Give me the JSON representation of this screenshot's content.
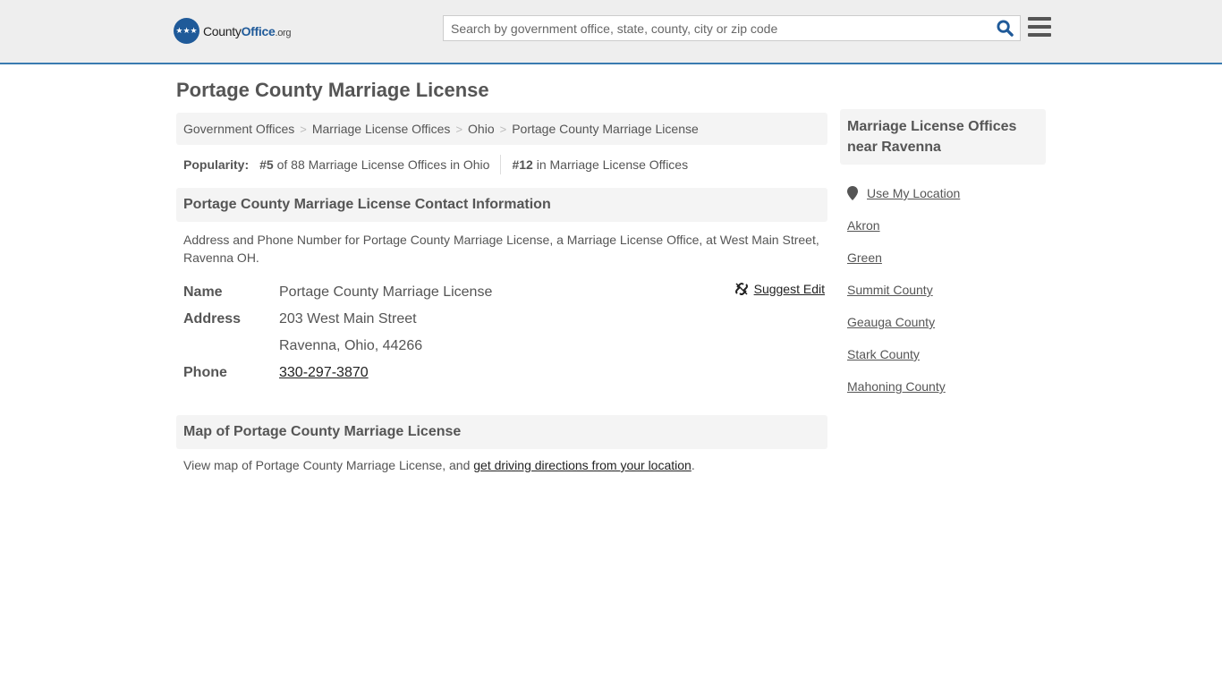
{
  "header": {
    "logo_text_a": "County",
    "logo_text_b": "Office",
    "logo_text_c": ".org",
    "search_placeholder": "Search by government office, state, county, city or zip code",
    "search_icon": "search-icon",
    "menu_icon": "hamburger-menu-icon"
  },
  "page": {
    "title": "Portage County Marriage License"
  },
  "breadcrumb": [
    "Government Offices",
    "Marriage License Offices",
    "Ohio",
    "Portage County Marriage License"
  ],
  "popularity": {
    "label": "Popularity:",
    "state_rank": "#5",
    "state_text": " of 88 Marriage License Offices in Ohio",
    "national_rank": "#12",
    "national_text": " in Marriage License Offices"
  },
  "contact": {
    "heading": "Portage County Marriage License Contact Information",
    "description": "Address and Phone Number for Portage County Marriage License, a Marriage License Office, at West Main Street, Ravenna OH.",
    "suggest_edit": "Suggest Edit",
    "name_label": "Name",
    "name_value": "Portage County Marriage License",
    "address_label": "Address",
    "address_line1": "203 West Main Street",
    "address_line2": "Ravenna, Ohio, 44266",
    "phone_label": "Phone",
    "phone_value": "330-297-3870"
  },
  "map": {
    "heading": "Map of Portage County Marriage License",
    "desc_prefix": "View map of Portage County Marriage License, and ",
    "desc_link": "get driving directions from your location",
    "desc_suffix": "."
  },
  "sidebar": {
    "heading": "Marriage License Offices near Ravenna",
    "use_location": "Use My Location",
    "items": [
      "Akron",
      "Green",
      "Summit County",
      "Geauga County",
      "Stark County",
      "Mahoning County"
    ]
  }
}
